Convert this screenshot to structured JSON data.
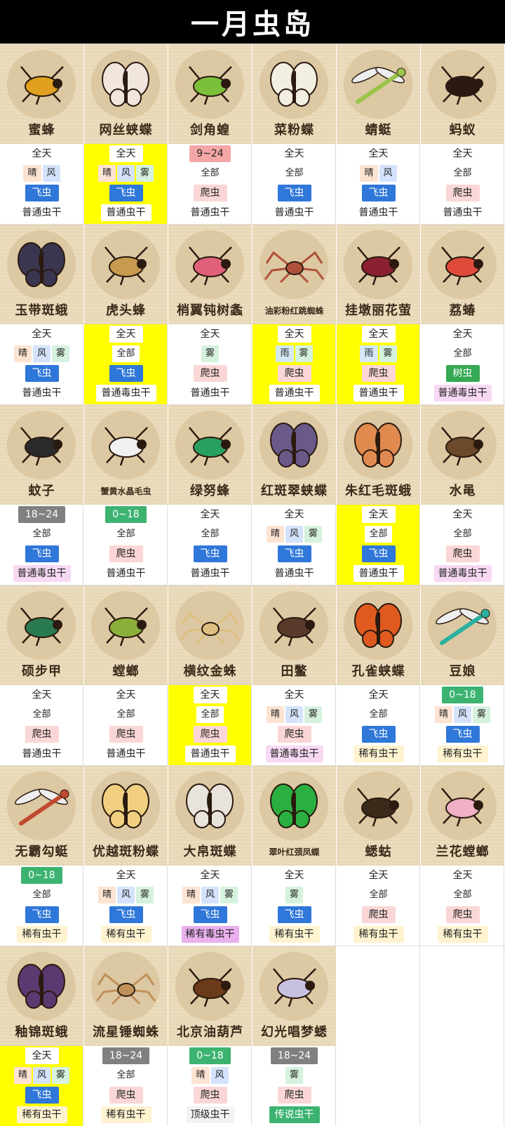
{
  "title": "一月虫岛",
  "bugs": [
    {
      "name": "蜜蜂",
      "hl": false,
      "time": "全天",
      "time_style": "plain",
      "weather": [
        "晴",
        "风"
      ],
      "type": "飞虫",
      "bait": "普通虫干",
      "bait_style": "norm",
      "icon": "bee-icon",
      "color": "#e0a020"
    },
    {
      "name": "网丝蛱蝶",
      "hl": true,
      "time": "全天",
      "time_style": "plain",
      "weather": [
        "晴",
        "风",
        "雾"
      ],
      "type": "飞虫",
      "bait": "普通虫干",
      "bait_style": "norm",
      "icon": "butterfly-icon",
      "color": "#f0e6de"
    },
    {
      "name": "剑角蝗",
      "hl": false,
      "time": "9~24",
      "time_style": "pink",
      "weather": [
        "全部"
      ],
      "type": "爬虫",
      "bait": "普通虫干",
      "bait_style": "norm",
      "icon": "grasshopper-icon",
      "color": "#7cbf3a"
    },
    {
      "name": "菜粉蝶",
      "hl": false,
      "time": "全天",
      "time_style": "plain",
      "weather": [
        "全部"
      ],
      "type": "飞虫",
      "bait": "普通虫干",
      "bait_style": "norm",
      "icon": "butterfly-icon",
      "color": "#f2eee0"
    },
    {
      "name": "蜻蜓",
      "hl": false,
      "time": "全天",
      "time_style": "plain",
      "weather": [
        "晴",
        "风"
      ],
      "type": "飞虫",
      "bait": "普通虫干",
      "bait_style": "norm",
      "icon": "dragonfly-icon",
      "color": "#9ac54a"
    },
    {
      "name": "蚂蚁",
      "hl": false,
      "time": "全天",
      "time_style": "plain",
      "weather": [
        "全部"
      ],
      "type": "爬虫",
      "bait": "普通虫干",
      "bait_style": "norm",
      "icon": "ant-icon",
      "color": "#2a1a12"
    },
    {
      "name": "玉带斑蛾",
      "hl": false,
      "time": "全天",
      "time_style": "plain",
      "weather": [
        "晴",
        "风",
        "雾"
      ],
      "type": "飞虫",
      "bait": "普通虫干",
      "bait_style": "norm",
      "icon": "moth-icon",
      "color": "#3a3650"
    },
    {
      "name": "虎头蜂",
      "hl": true,
      "time": "全天",
      "time_style": "plain",
      "weather": [
        "全部"
      ],
      "type": "飞虫",
      "bait": "普通毒虫干",
      "bait_style": "norm",
      "icon": "hornet-icon",
      "color": "#c89a50"
    },
    {
      "name": "梢翼钝树螽",
      "hl": false,
      "time": "全天",
      "time_style": "plain",
      "weather": [
        "雾"
      ],
      "type": "爬虫",
      "bait": "普通虫干",
      "bait_style": "norm",
      "icon": "katydid-icon",
      "color": "#e0607a"
    },
    {
      "name": "油彩粉红跳蜘蛛",
      "hl": true,
      "time": "全天",
      "time_style": "yellow",
      "weather": [
        "雨",
        "雾"
      ],
      "type": "爬虫",
      "bait": "普通虫干",
      "bait_style": "norm",
      "icon": "spider-icon",
      "color": "#b0503a",
      "small": true
    },
    {
      "name": "挂墩丽花萤",
      "hl": true,
      "time": "全天",
      "time_style": "plain",
      "weather": [
        "雨",
        "雾"
      ],
      "type": "爬虫",
      "bait": "普通虫干",
      "bait_style": "norm",
      "icon": "firefly-icon",
      "color": "#8a2030"
    },
    {
      "name": "荔蝽",
      "hl": false,
      "time": "全天",
      "time_style": "plain",
      "weather": [
        "全部"
      ],
      "type": "树虫",
      "bait": "普通毒虫干",
      "bait_style": "pois",
      "icon": "stinkbug-icon",
      "color": "#e04a3a"
    },
    {
      "name": "蚊子",
      "hl": false,
      "time": "18~24",
      "time_style": "gray",
      "weather": [
        "全部"
      ],
      "type": "飞虫",
      "bait": "普通毒虫干",
      "bait_style": "pois",
      "icon": "mosquito-icon",
      "color": "#2a2a2a"
    },
    {
      "name": "蟹黄水晶毛虫",
      "hl": false,
      "time": "0~18",
      "time_style": "green",
      "weather": [
        "全部"
      ],
      "type": "爬虫",
      "bait": "普通虫干",
      "bait_style": "norm",
      "icon": "caterpillar-icon",
      "color": "#f0f0f0",
      "small": true
    },
    {
      "name": "绿努蜂",
      "hl": false,
      "time": "全天",
      "time_style": "plain",
      "weather": [
        "全部"
      ],
      "type": "飞虫",
      "bait": "普通虫干",
      "bait_style": "norm",
      "icon": "wasp-icon",
      "color": "#2aa060"
    },
    {
      "name": "红斑翠蛱蝶",
      "hl": false,
      "time": "全天",
      "time_style": "plain",
      "weather": [
        "晴",
        "风",
        "雾"
      ],
      "type": "飞虫",
      "bait": "普通虫干",
      "bait_style": "norm",
      "icon": "butterfly-icon",
      "color": "#6a5a8a"
    },
    {
      "name": "朱红毛斑蛾",
      "hl": true,
      "time": "全天",
      "time_style": "plain",
      "weather": [
        "全部"
      ],
      "type": "飞虫",
      "bait": "普通虫干",
      "bait_style": "norm",
      "icon": "moth-icon",
      "color": "#e08a50"
    },
    {
      "name": "水黾",
      "hl": false,
      "time": "全天",
      "time_style": "plain",
      "weather": [
        "全部"
      ],
      "type": "爬虫",
      "bait": "普通毒虫干",
      "bait_style": "pois",
      "icon": "waterstrider-icon",
      "color": "#6a4a2a"
    },
    {
      "name": "硕步甲",
      "hl": false,
      "time": "全天",
      "time_style": "plain",
      "weather": [
        "全部"
      ],
      "type": "爬虫",
      "bait": "普通虫干",
      "bait_style": "norm",
      "icon": "beetle-icon",
      "color": "#2a7a50"
    },
    {
      "name": "螳螂",
      "hl": false,
      "time": "全天",
      "time_style": "plain",
      "weather": [
        "全部"
      ],
      "type": "爬虫",
      "bait": "普通虫干",
      "bait_style": "norm",
      "icon": "mantis-icon",
      "color": "#8ab03a"
    },
    {
      "name": "横纹金蛛",
      "hl": true,
      "time": "全天",
      "time_style": "plain",
      "weather": [
        "全部"
      ],
      "type": "爬虫",
      "bait": "普通虫干",
      "bait_style": "norm",
      "icon": "spider-icon",
      "color": "#e0c080"
    },
    {
      "name": "田鳖",
      "hl": false,
      "time": "全天",
      "time_style": "plain",
      "weather": [
        "晴",
        "风",
        "雾"
      ],
      "type": "爬虫",
      "bait": "普通毒虫干",
      "bait_style": "pois",
      "icon": "waterbug-icon",
      "color": "#5a3a2a"
    },
    {
      "name": "孔雀蛱蝶",
      "hl": false,
      "time": "全天",
      "time_style": "plain",
      "weather": [
        "全部"
      ],
      "type": "飞虫",
      "bait": "稀有虫干",
      "bait_style": "rare",
      "icon": "butterfly-icon",
      "color": "#e05a20"
    },
    {
      "name": "豆娘",
      "hl": false,
      "time": "0~18",
      "time_style": "green",
      "weather": [
        "晴",
        "风",
        "雾"
      ],
      "type": "飞虫",
      "bait": "稀有虫干",
      "bait_style": "rare",
      "icon": "damselfly-icon",
      "color": "#2ab0a0"
    },
    {
      "name": "无霸勾蜓",
      "hl": false,
      "time": "0~18",
      "time_style": "green",
      "weather": [
        "全部"
      ],
      "type": "飞虫",
      "bait": "稀有虫干",
      "bait_style": "rare",
      "icon": "dragonfly-icon",
      "color": "#c04a30"
    },
    {
      "name": "优越斑粉蝶",
      "hl": false,
      "time": "全天",
      "time_style": "plain",
      "weather": [
        "晴",
        "风",
        "雾"
      ],
      "type": "飞虫",
      "bait": "稀有虫干",
      "bait_style": "rare",
      "icon": "butterfly-icon",
      "color": "#f0d080"
    },
    {
      "name": "大帛斑蝶",
      "hl": false,
      "time": "全天",
      "time_style": "plain",
      "weather": [
        "晴",
        "风",
        "雾"
      ],
      "type": "飞虫",
      "bait": "稀有毒虫干",
      "bait_style": "rpois",
      "icon": "butterfly-icon",
      "color": "#e8e4dc"
    },
    {
      "name": "翠叶红颈凤蝶",
      "hl": false,
      "time": "全天",
      "time_style": "plain",
      "weather": [
        "雾"
      ],
      "type": "飞虫",
      "bait": "稀有虫干",
      "bait_style": "rare",
      "icon": "swallowtail-icon",
      "color": "#2ab040",
      "small": true
    },
    {
      "name": "蟋蛄",
      "hl": false,
      "time": "全天",
      "time_style": "plain",
      "weather": [
        "全部"
      ],
      "type": "爬虫",
      "bait": "稀有虫干",
      "bait_style": "rare",
      "icon": "cricket-icon",
      "color": "#3a2a1a"
    },
    {
      "name": "兰花螳螂",
      "hl": false,
      "time": "全天",
      "time_style": "plain",
      "weather": [
        "全部"
      ],
      "type": "爬虫",
      "bait": "稀有虫干",
      "bait_style": "rare",
      "icon": "mantis-icon",
      "color": "#f0b0c8"
    },
    {
      "name": "釉锦斑蛾",
      "hl": true,
      "time": "全天",
      "time_style": "plain",
      "weather": [
        "晴",
        "风",
        "雾"
      ],
      "type": "飞虫",
      "bait": "稀有虫干",
      "bait_style": "rare",
      "icon": "moth-icon",
      "color": "#5a3a70"
    },
    {
      "name": "流星锤蜘蛛",
      "hl": false,
      "time": "18~24",
      "time_style": "gray",
      "weather": [
        "全部"
      ],
      "type": "爬虫",
      "bait": "稀有虫干",
      "bait_style": "rare",
      "icon": "spider-icon",
      "color": "#c0905a"
    },
    {
      "name": "北京油葫芦",
      "hl": false,
      "time": "0~18",
      "time_style": "green",
      "weather": [
        "晴",
        "风"
      ],
      "type": "爬虫",
      "bait": "顶级虫干",
      "bait_style": "top",
      "icon": "cricket-icon",
      "color": "#6a3a1a"
    },
    {
      "name": "幻光唱梦蟋",
      "hl": false,
      "time": "18~24",
      "time_style": "gray",
      "weather": [
        "雾"
      ],
      "type": "爬虫",
      "bait": "传说虫干",
      "bait_style": "leg",
      "icon": "cricket-icon",
      "color": "#c8c0e0"
    }
  ]
}
